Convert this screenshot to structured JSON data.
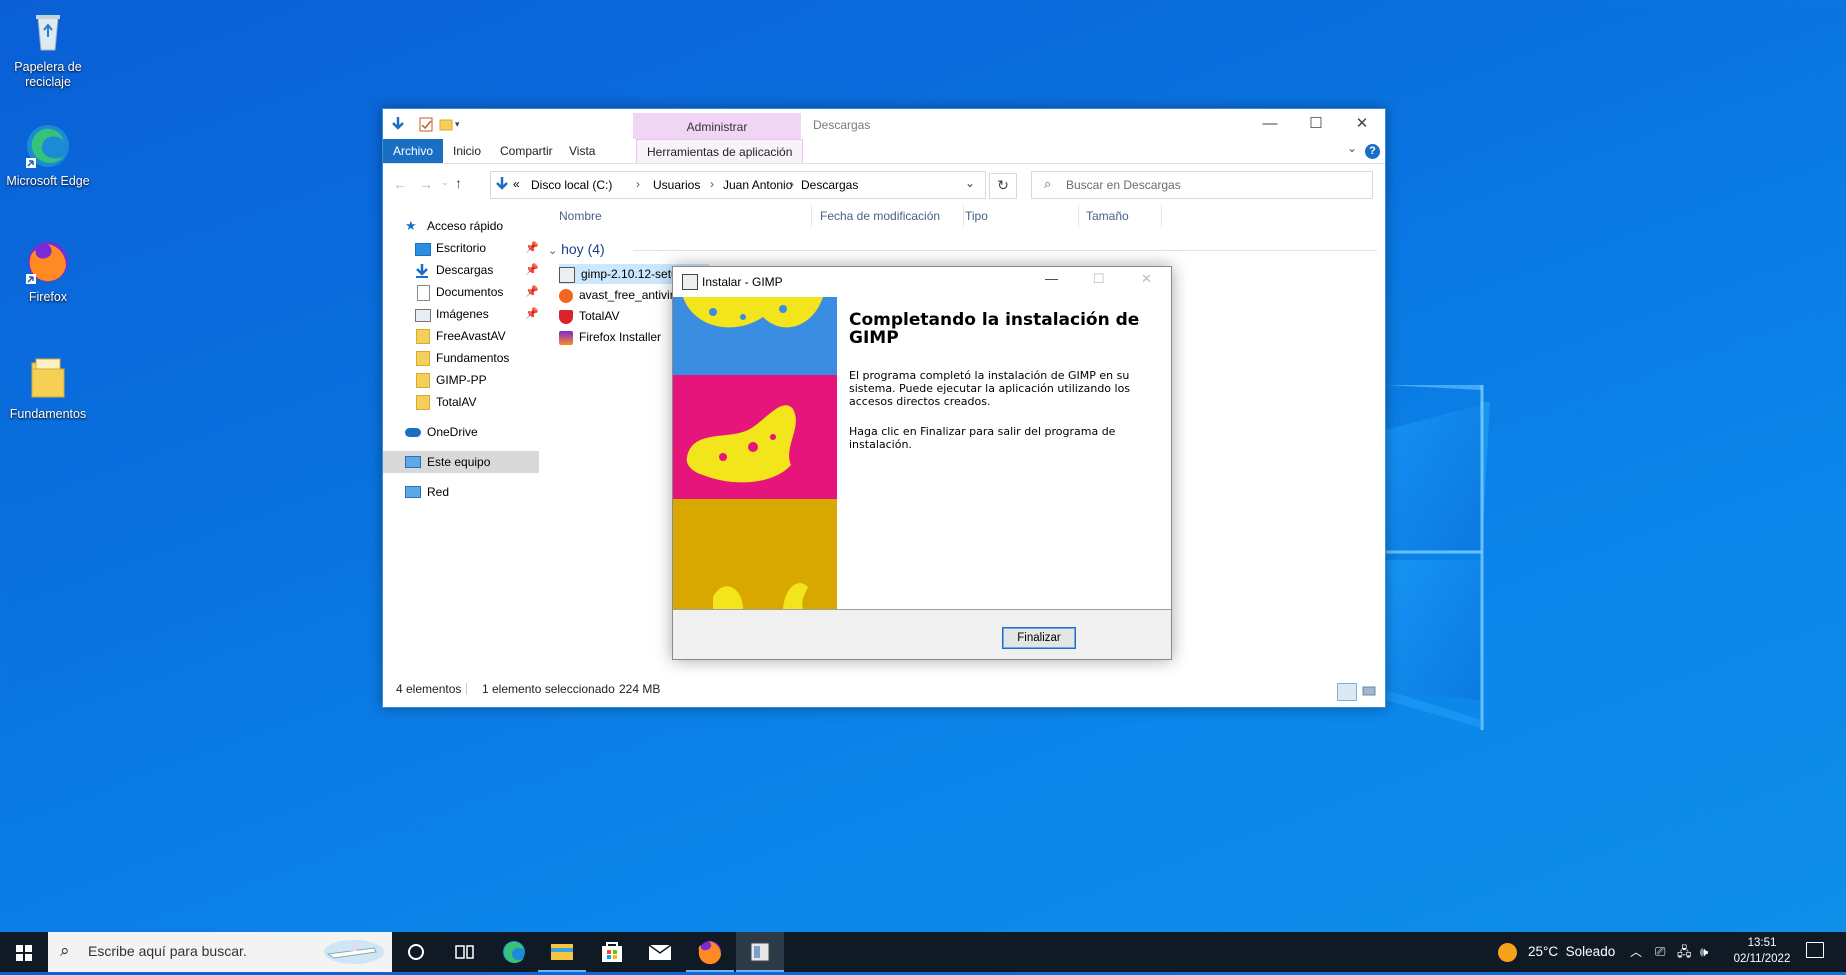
{
  "desktop": {
    "icons": [
      {
        "label_line1": "Papelera de",
        "label_line2": "reciclaje",
        "icon": "recycle-bin-icon"
      },
      {
        "label": "Microsoft Edge",
        "icon": "edge-icon"
      },
      {
        "label": "Firefox",
        "icon": "firefox-icon"
      },
      {
        "label": "Fundamentos",
        "icon": "folder-icon"
      }
    ]
  },
  "explorer": {
    "contextual_tab": "Administrar",
    "window_title": "Descargas",
    "ribbon_tabs": [
      "Archivo",
      "Inicio",
      "Compartir",
      "Vista",
      "Herramientas de aplicación"
    ],
    "breadcrumb": {
      "prefix": "«",
      "parts": [
        "Disco local (C:)",
        "Usuarios",
        "Juan Antonio",
        "Descargas"
      ]
    },
    "search_placeholder": "Buscar en Descargas",
    "nav": {
      "quick_access": "Acceso rápido",
      "items": [
        "Escritorio",
        "Descargas",
        "Documentos",
        "Imágenes",
        "FreeAvastAV",
        "Fundamentos",
        "GIMP-PP",
        "TotalAV"
      ],
      "onedrive": "OneDrive",
      "this_pc": "Este equipo",
      "network": "Red"
    },
    "columns": [
      "Nombre",
      "Fecha de modificación",
      "Tipo",
      "Tamaño"
    ],
    "group_label": "hoy (4)",
    "files": [
      "gimp-2.10.12-setup",
      "avast_free_antivirus",
      "TotalAV",
      "Firefox Installer"
    ],
    "status": {
      "count": "4 elementos",
      "selection": "1 elemento seleccionado",
      "size": "224 MB"
    }
  },
  "dialog": {
    "title": "Instalar - GIMP",
    "heading": "Completando la instalación de GIMP",
    "para1": "El programa completó la instalación de GIMP en su sistema. Puede ejecutar la aplicación utilizando los accesos directos creados.",
    "para2": "Haga clic en Finalizar para salir del programa de instalación.",
    "finish_label": "Finalizar"
  },
  "taskbar": {
    "search_placeholder": "Escribe aquí para buscar.",
    "weather": "25°C  Soleado",
    "time": "13:51",
    "date": "02/11/2022"
  }
}
